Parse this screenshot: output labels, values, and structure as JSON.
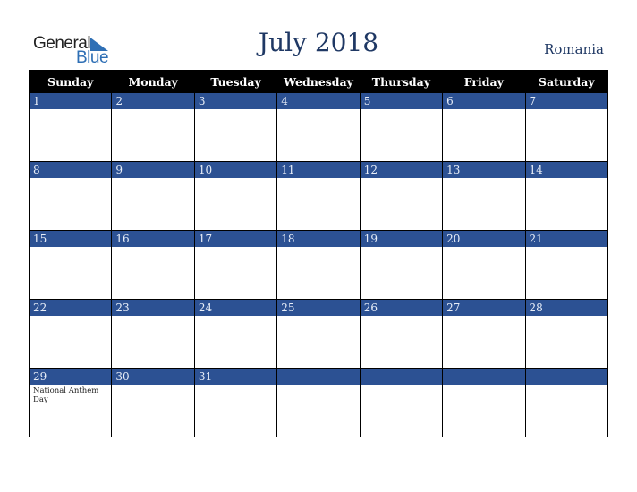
{
  "logo": {
    "word1": "General",
    "word2": "Blue"
  },
  "header": {
    "title": "July 2018",
    "country": "Romania"
  },
  "colors": {
    "accent": "#2c5193",
    "header_bg": "#000000",
    "title": "#1f3864",
    "logo_blue": "#2e6fb5"
  },
  "weekdays": [
    "Sunday",
    "Monday",
    "Tuesday",
    "Wednesday",
    "Thursday",
    "Friday",
    "Saturday"
  ],
  "weeks": [
    [
      {
        "day": "1",
        "event": ""
      },
      {
        "day": "2",
        "event": ""
      },
      {
        "day": "3",
        "event": ""
      },
      {
        "day": "4",
        "event": ""
      },
      {
        "day": "5",
        "event": ""
      },
      {
        "day": "6",
        "event": ""
      },
      {
        "day": "7",
        "event": ""
      }
    ],
    [
      {
        "day": "8",
        "event": ""
      },
      {
        "day": "9",
        "event": ""
      },
      {
        "day": "10",
        "event": ""
      },
      {
        "day": "11",
        "event": ""
      },
      {
        "day": "12",
        "event": ""
      },
      {
        "day": "13",
        "event": ""
      },
      {
        "day": "14",
        "event": ""
      }
    ],
    [
      {
        "day": "15",
        "event": ""
      },
      {
        "day": "16",
        "event": ""
      },
      {
        "day": "17",
        "event": ""
      },
      {
        "day": "18",
        "event": ""
      },
      {
        "day": "19",
        "event": ""
      },
      {
        "day": "20",
        "event": ""
      },
      {
        "day": "21",
        "event": ""
      }
    ],
    [
      {
        "day": "22",
        "event": ""
      },
      {
        "day": "23",
        "event": ""
      },
      {
        "day": "24",
        "event": ""
      },
      {
        "day": "25",
        "event": ""
      },
      {
        "day": "26",
        "event": ""
      },
      {
        "day": "27",
        "event": ""
      },
      {
        "day": "28",
        "event": ""
      }
    ],
    [
      {
        "day": "29",
        "event": "National Anthem Day"
      },
      {
        "day": "30",
        "event": ""
      },
      {
        "day": "31",
        "event": ""
      },
      {
        "day": "",
        "event": ""
      },
      {
        "day": "",
        "event": ""
      },
      {
        "day": "",
        "event": ""
      },
      {
        "day": "",
        "event": ""
      }
    ]
  ]
}
